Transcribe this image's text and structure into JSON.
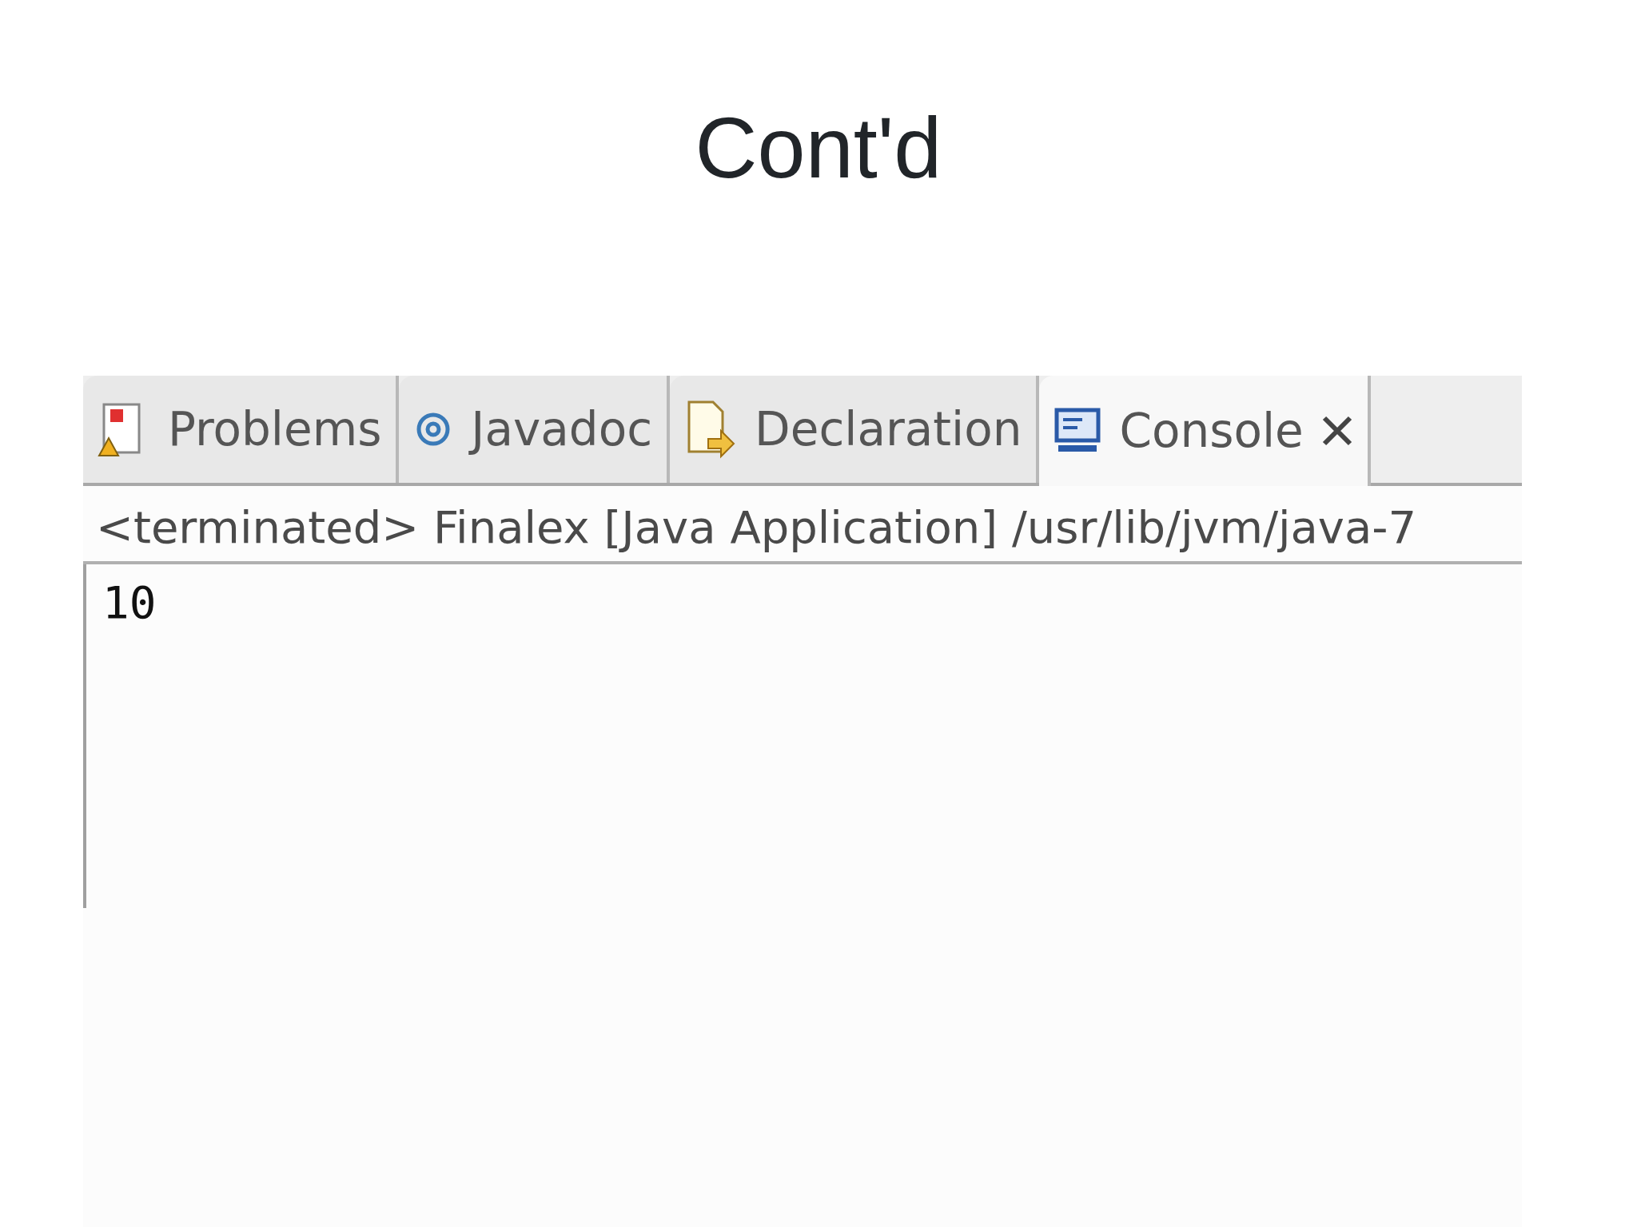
{
  "slide": {
    "title": "Cont'd"
  },
  "tabs": [
    {
      "label": "Problems",
      "kind": "problems",
      "selected": false
    },
    {
      "label": "Javadoc",
      "kind": "javadoc",
      "selected": false
    },
    {
      "label": "Declaration",
      "kind": "declaration",
      "selected": false
    },
    {
      "label": "Console",
      "kind": "console",
      "selected": true
    }
  ],
  "console": {
    "header": "<terminated> Finalex [Java Application] /usr/lib/jvm/java-7",
    "output": "10"
  }
}
